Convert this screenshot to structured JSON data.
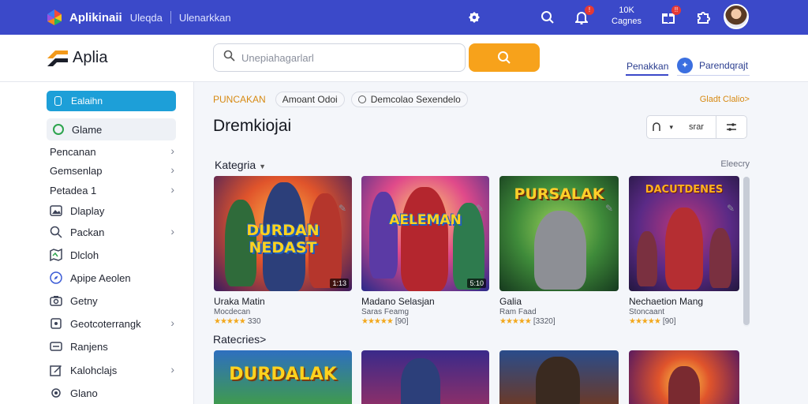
{
  "topbar": {
    "brand": "Aplikinaii",
    "link1": "Uleqda",
    "link2": "Ulenarkkan",
    "stat_line1": "10K",
    "stat_line2": "Cagnes",
    "bell_badge": "!",
    "gift_badge": "!!"
  },
  "header": {
    "logo_text": "Aplia",
    "search_placeholder": "Unepiahagarlarl",
    "link": "Penakkan",
    "button": "Parendqrajt"
  },
  "sidebar": {
    "active": "Ealaihn",
    "highlighted": "Glame",
    "items": [
      {
        "label": "Pencanan",
        "icon": "none",
        "chevron": true
      },
      {
        "label": "Gemsenlap",
        "icon": "none",
        "chevron": true
      },
      {
        "label": "Petadea 1",
        "icon": "none",
        "chevron": true
      },
      {
        "label": "Dlaplay",
        "icon": "gallery-icon",
        "chevron": false
      },
      {
        "label": "Packan",
        "icon": "search-icon",
        "chevron": true
      },
      {
        "label": "Dlcloh",
        "icon": "map-icon",
        "chevron": false
      },
      {
        "label": "Apipe Aeolen",
        "icon": "compass-icon",
        "chevron": false
      },
      {
        "label": "Getny",
        "icon": "camera-icon",
        "chevron": false
      },
      {
        "label": "Geotcoterrangk",
        "icon": "document-icon",
        "chevron": true
      },
      {
        "label": "Ranjens",
        "icon": "keyboard-icon",
        "chevron": false
      },
      {
        "label": "Kalohclajs",
        "icon": "edit-icon",
        "chevron": true
      },
      {
        "label": "Glano",
        "icon": "gear-icon",
        "chevron": false
      }
    ]
  },
  "main": {
    "chip_label": "PUNCAKAN",
    "chip1": "Amoant Odoi",
    "chip2": "Demcolao Sexendelo",
    "see_all": "Gladt Clalio>",
    "title": "Dremkiojai",
    "sort_label": "srar",
    "category": "Kategria",
    "category_right": "Eleecry",
    "section2": "Ratecries>",
    "cards": [
      {
        "title_art": "DURDAN NEDAST",
        "name": "Uraka Matin",
        "dev": "Mocdecan",
        "rating": "330",
        "badge": "1:13"
      },
      {
        "title_art": "AELEMAN",
        "name": "Madano Selasjan",
        "dev": "Saras Feamg",
        "rating": "[90]",
        "badge": "5:10"
      },
      {
        "title_art": "PURSALAK",
        "name": "Galia",
        "dev": "Ram Faad",
        "rating": "[3320]",
        "badge": ""
      },
      {
        "title_art": "DACUTDENES",
        "name": "Nechaetion Mang",
        "dev": "Stoncaant",
        "rating": "[90]",
        "badge": ""
      }
    ],
    "row2": [
      {
        "title_art": "DURDALAK"
      },
      {
        "title_art": ""
      },
      {
        "title_art": ""
      },
      {
        "title_art": ""
      }
    ]
  },
  "colors": {
    "topbar": "#3b49c9",
    "accent_orange": "#f7a21b",
    "sidebar_active": "#1d9fd8",
    "star": "#f2a81d"
  }
}
